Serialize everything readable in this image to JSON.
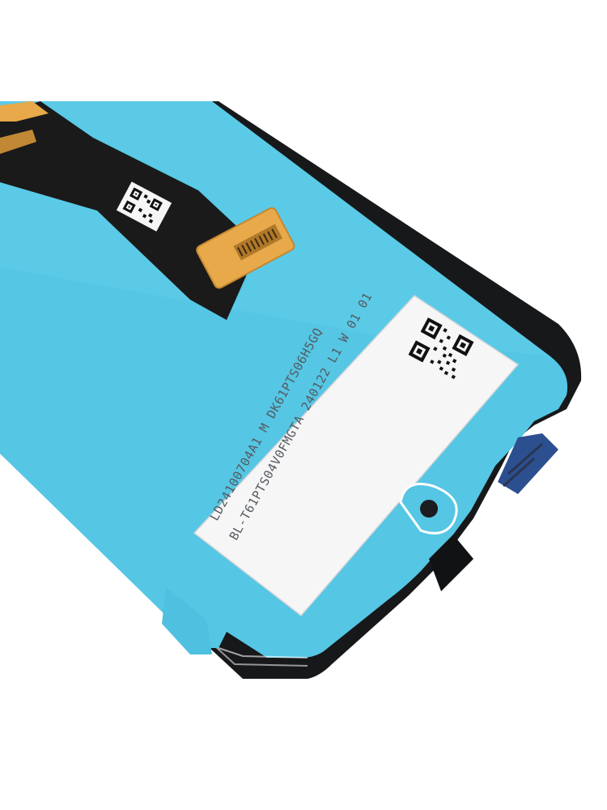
{
  "product": {
    "label_lines": [
      "LD24100704A1 M DK61PTS06H5GQ",
      "BL-T61PTS04V0FMGTA 240122 L1 W 01 01"
    ]
  },
  "colors": {
    "frame": "#16181a",
    "protective_film": "#55c6e4",
    "flex_cable": "#1a1a1a",
    "connector": "#e7a94a",
    "label": "#f6f6f6",
    "qr": "#111111"
  },
  "icons": {
    "label_qr": "qr-code-icon",
    "cable_qr": "qr-code-icon"
  }
}
